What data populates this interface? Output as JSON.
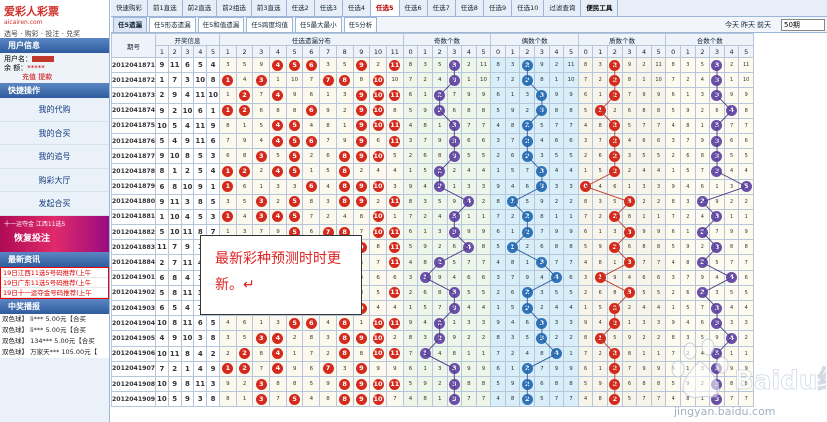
{
  "logo": {
    "name": "爱彩人彩票",
    "domain": "aicairen.com",
    "slogan": "选号 · 购彩 · 投注 · 兑奖"
  },
  "sidebar": {
    "user_section": "用户信息",
    "user_label": "用户名：",
    "balance_label": "余 额：",
    "balance_value": "*****",
    "links": "充值  提款",
    "quick_section": "快捷操作",
    "quick_items": [
      "我的代购",
      "我的合买",
      "我的追号",
      "购彩大厅",
      "发起合买"
    ],
    "banner_top": "十一运夺金 江西11选5",
    "banner_main": "恢复投注",
    "news_section": "最新资讯",
    "news": [
      "19日江西11选5号码推荐(上午",
      "19日广东11选5号码推荐(上午",
      "19日十一运夺金号码推荐(上午"
    ],
    "winners_section": "中奖播报",
    "winners": [
      "双色球】 li*** 5.00元【合买",
      "双色球】 li*** 5.00元【合买",
      "双色球】 134*** 5.00元【合买",
      "双色球】 万家天*** 105.00元【"
    ]
  },
  "tabs_top": [
    "快速购彩",
    "前1直选",
    "前2直选",
    "前2组选",
    "前3直选",
    "任选2",
    "任选3",
    "任选4",
    "任选5",
    "任选6",
    "任选7",
    "任选8",
    "任选9",
    "任选10",
    "过滤查询",
    "便民工具"
  ],
  "tabs_top_active": 8,
  "tabs_sub": [
    "任5遗漏",
    "任5形态遗漏",
    "任5和值遗漏",
    "任5跨度均值",
    "任5最大最小",
    "任5分析"
  ],
  "tabs_sub_active": 0,
  "quick_dates": [
    "今天",
    "昨天",
    "前天"
  ],
  "count_value": "50期",
  "headers": {
    "period": "期号",
    "kaijiang": "开奖信息",
    "distribution": "任选遗漏分布",
    "odd": "奇数个数",
    "even": "偶数个数",
    "prime": "质数个数",
    "comp": "合数个数",
    "kj_cols": [
      "1",
      "2",
      "3",
      "4",
      "5"
    ],
    "dist_cols": [
      "1",
      "2",
      "3",
      "4",
      "5",
      "6",
      "7",
      "8",
      "9",
      "10",
      "11"
    ],
    "cnt_cols": [
      "0",
      "1",
      "2",
      "3",
      "4",
      "5"
    ]
  },
  "rows": [
    {
      "period": "2012041871",
      "nums": [
        9,
        11,
        6,
        5,
        4
      ],
      "miss": [
        8,
        3,
        5,
        9,
        2,
        11
      ]
    },
    {
      "period": "2012041872",
      "nums": [
        1,
        7,
        3,
        10,
        8
      ],
      "miss": [
        7,
        2,
        4,
        8,
        1,
        10
      ]
    },
    {
      "period": "2012041873",
      "nums": [
        2,
        9,
        4,
        11,
        10
      ],
      "miss": [
        6,
        1,
        3,
        7,
        9,
        9
      ]
    },
    {
      "period": "2012041874",
      "nums": [
        9,
        2,
        10,
        6,
        1
      ],
      "miss": [
        5,
        9,
        2,
        6,
        8,
        8
      ]
    },
    {
      "period": "2012041875",
      "nums": [
        10,
        5,
        4,
        11,
        9
      ],
      "miss": [
        4,
        8,
        1,
        5,
        7,
        7
      ]
    },
    {
      "period": "2012041876",
      "nums": [
        5,
        4,
        9,
        11,
        6
      ],
      "miss": [
        3,
        7,
        9,
        4,
        6,
        6
      ]
    },
    {
      "period": "2012041877",
      "nums": [
        9,
        10,
        8,
        5,
        3
      ],
      "miss": [
        2,
        6,
        8,
        3,
        5,
        5
      ]
    },
    {
      "period": "2012041878",
      "nums": [
        8,
        1,
        2,
        5,
        4
      ],
      "miss": [
        1,
        5,
        7,
        2,
        4,
        4
      ]
    },
    {
      "period": "2012041879",
      "nums": [
        6,
        8,
        10,
        9,
        1
      ],
      "miss": [
        9,
        4,
        6,
        1,
        3,
        3
      ]
    },
    {
      "period": "2012041880",
      "nums": [
        9,
        11,
        3,
        8,
        5
      ],
      "miss": [
        8,
        3,
        5,
        9,
        2,
        2
      ]
    },
    {
      "period": "2012041881",
      "nums": [
        1,
        10,
        4,
        5,
        3
      ],
      "miss": [
        7,
        2,
        4,
        8,
        1,
        1
      ]
    },
    {
      "period": "2012041882",
      "nums": [
        5,
        10,
        11,
        8,
        7
      ],
      "miss": [
        6,
        1,
        3,
        7,
        9,
        9
      ]
    },
    {
      "period": "2012041883",
      "nums": [
        11,
        7,
        9,
        1,
        6
      ],
      "miss": [
        5,
        9,
        2,
        6,
        8,
        8
      ]
    },
    {
      "period": "2012041884",
      "nums": [
        2,
        7,
        11,
        4,
        8
      ],
      "miss": [
        4,
        8,
        1,
        5,
        7,
        7
      ]
    },
    {
      "period": "2012041901",
      "nums": [
        6,
        8,
        4,
        1,
        2
      ],
      "miss": [
        3,
        7,
        9,
        4,
        6,
        6
      ]
    },
    {
      "period": "2012041902",
      "nums": [
        5,
        8,
        11,
        3,
        4
      ],
      "miss": [
        2,
        6,
        8,
        3,
        5,
        5
      ]
    },
    {
      "period": "2012041903",
      "nums": [
        6,
        5,
        4,
        7,
        9
      ],
      "miss": [
        1,
        5,
        7,
        2,
        4,
        4
      ]
    },
    {
      "period": "2012041904",
      "nums": [
        10,
        8,
        11,
        6,
        5
      ],
      "miss": [
        9,
        4,
        6,
        1,
        3,
        3
      ]
    },
    {
      "period": "2012041905",
      "nums": [
        4,
        9,
        10,
        3,
        8
      ],
      "miss": [
        8,
        3,
        5,
        9,
        2,
        2
      ]
    },
    {
      "period": "2012041906",
      "nums": [
        10,
        11,
        8,
        4,
        2
      ],
      "miss": [
        7,
        2,
        4,
        8,
        1,
        1
      ]
    },
    {
      "period": "2012041907",
      "nums": [
        7,
        2,
        1,
        4,
        9
      ],
      "miss": [
        6,
        1,
        3,
        7,
        9,
        9
      ]
    },
    {
      "period": "2012041908",
      "nums": [
        10,
        9,
        8,
        11,
        3
      ],
      "miss": [
        5,
        9,
        2,
        6,
        8,
        8
      ]
    },
    {
      "period": "2012041909",
      "nums": [
        10,
        5,
        9,
        3,
        8
      ],
      "miss": [
        4,
        8,
        1,
        5,
        7,
        7
      ]
    }
  ],
  "stat_counts": [
    3,
    3,
    3,
    4,
    3,
    2,
    3,
    3,
    2,
    4,
    3,
    2,
    3,
    2,
    2,
    3,
    4,
    1,
    3,
    1,
    3,
    3,
    4
  ],
  "callout": "最新彩种预测时时更新。↵",
  "watermark": {
    "brand": "Baidu经验",
    "url": "jingyan.baidu.com"
  },
  "colors": {
    "red_ball": "#d42a1e",
    "purple_ball": "#6a4fa8",
    "blue_ball": "#2f73b8",
    "header_blue": "#2f5c9e",
    "callout_text": "#d22222"
  }
}
